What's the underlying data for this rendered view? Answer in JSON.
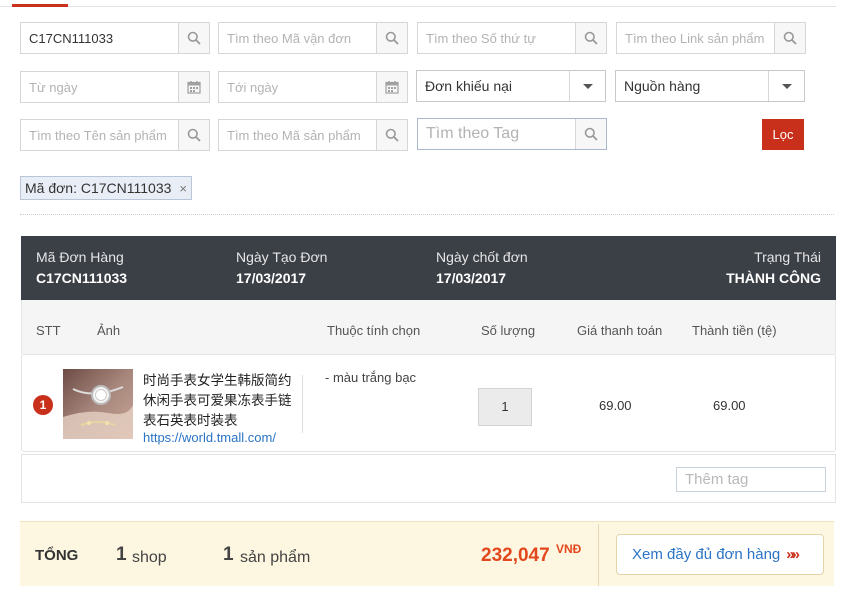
{
  "filters": {
    "order_code_value": "C17CN111033",
    "tracking_placeholder": "Tìm theo Mã vận đơn",
    "seq_placeholder": "Tìm theo Số thứ tự",
    "link_placeholder": "Tìm theo Link sản phẩm",
    "from_date_placeholder": "Từ ngày",
    "to_date_placeholder": "Tới ngày",
    "complaint_select": "Đơn khiếu nại",
    "source_select": "Nguồn hàng",
    "product_name_placeholder": "Tìm theo Tên sản phẩm",
    "product_code_placeholder": "Tìm theo Mã sản phẩm",
    "tag_placeholder": "Tìm theo Tag",
    "filter_button": "Lọc"
  },
  "active_filter": {
    "label": "Mã đơn: C17CN111033",
    "remove": "×"
  },
  "order": {
    "code_label": "Mã Đơn Hàng",
    "code": "C17CN111033",
    "created_label": "Ngày Tạo Đơn",
    "created": "17/03/2017",
    "closed_label": "Ngày chốt đơn",
    "closed": "17/03/2017",
    "status_label": "Trạng Thái",
    "status": "THÀNH CÔNG"
  },
  "columns": [
    "STT",
    "Ảnh",
    "Thuộc tính chọn",
    "Số lượng",
    "Giá thanh toán",
    "Thành tiền (tệ)"
  ],
  "items": [
    {
      "stt": "1",
      "name": "时尚手表女学生韩版简约休闲手表可爱果冻表手链表石英表时装表",
      "link": "https://world.tmall.com/",
      "attribute": "- màu trắng bạc",
      "quantity": "1",
      "price": "69.00",
      "total": "69.00"
    }
  ],
  "tag_input_placeholder": "Thêm tag",
  "summary": {
    "label": "TỔNG",
    "shop_count": "1",
    "shop_label": "shop",
    "product_count": "1",
    "product_label": "sản phẩm",
    "amount": "232,047",
    "currency": "VNĐ",
    "view_button": "Xem đầy đủ đơn hàng",
    "view_arrows": "»»"
  },
  "icons": [
    "search-icon",
    "calendar-icon",
    "chevron-down-icon",
    "close-icon"
  ],
  "colors": {
    "accent": "#c9301c",
    "header_bg": "#3b3f46",
    "link": "#2a74c5",
    "summary_bg": "#fdf6e1"
  }
}
